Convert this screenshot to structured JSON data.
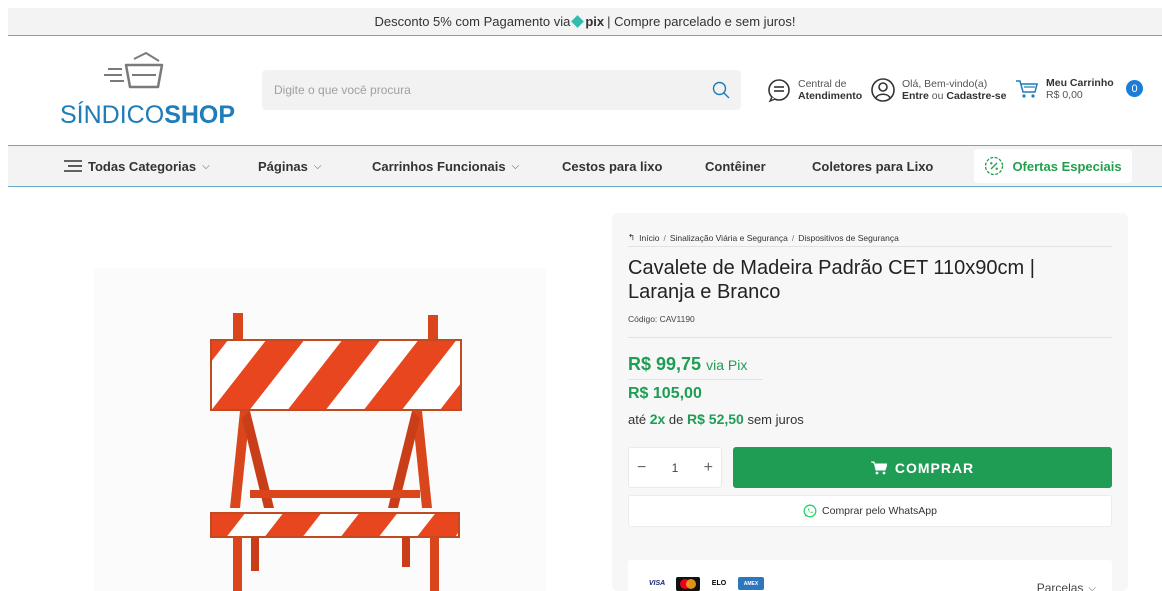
{
  "topbar": {
    "text_before": "Desconto 5% com Pagamento via",
    "pix_label": "pix",
    "text_after": "| Compre parcelado e sem juros!"
  },
  "logo": {
    "part1": "SÍNDICO",
    "part2": "SHOP"
  },
  "search": {
    "placeholder": "Digite o que você procura"
  },
  "header": {
    "atendimento": {
      "line1": "Central de",
      "line2": "Atendimento"
    },
    "login": {
      "line1": "Olá, Bem-vindo(a)",
      "enter": "Entre",
      "or": "ou",
      "register": "Cadastre-se"
    },
    "cart": {
      "title": "Meu Carrinho",
      "total": "R$ 0,00",
      "count": "0"
    }
  },
  "nav": {
    "categories": "Todas Categorias",
    "pages": "Páginas",
    "carts": "Carrinhos Funcionais",
    "bins": "Cestos para lixo",
    "container": "Contêiner",
    "collectors": "Coletores para Lixo",
    "offers": "Ofertas Especiais"
  },
  "breadcrumb": {
    "home": "Início",
    "sep": "/",
    "level1": "Sinalização Viária e Segurança",
    "level2": "Dispositivos de Segurança"
  },
  "product": {
    "title": "Cavalete de Madeira Padrão CET 110x90cm | Laranja e Branco",
    "sku": "Código: CAV1190",
    "price_pix": "R$ 99,75",
    "price_pix_suffix": "via Pix",
    "price_full": "R$ 105,00",
    "installments_prefix": "até",
    "installments_count": "2x",
    "installments_of": "de",
    "installments_value": "R$ 52,50",
    "installments_suffix": "sem juros",
    "quantity": "1",
    "buy_label": "COMPRAR",
    "whatsapp_label": "Comprar pelo WhatsApp"
  },
  "payment": {
    "cards": [
      "VISA",
      "MC",
      "ELO",
      "AMEX"
    ],
    "parcelas_label": "Parcelas"
  },
  "colors": {
    "primary_blue": "#1e7cb8",
    "green": "#1f9d55",
    "badge_blue": "#1a7ed9"
  }
}
